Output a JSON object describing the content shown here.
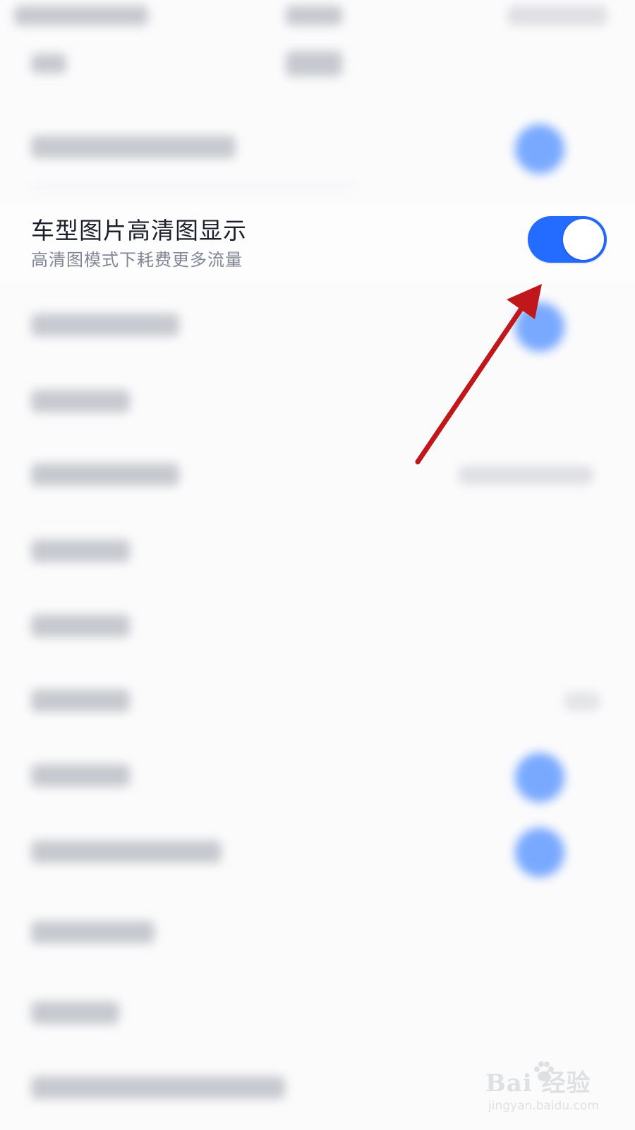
{
  "setting": {
    "title": "车型图片高清图显示",
    "description": "高清图模式下耗费更多流量",
    "toggle_on": true
  },
  "watermark": {
    "brand": "Bai  经验",
    "url": "jingyan.baidu.com"
  },
  "colors": {
    "toggle_on": "#246bff",
    "annotation_arrow": "#c0181a",
    "blurred_toggle": "#6aa0ff"
  },
  "icons": [
    "baidu-paw-icon",
    "annotation-arrow-icon"
  ]
}
